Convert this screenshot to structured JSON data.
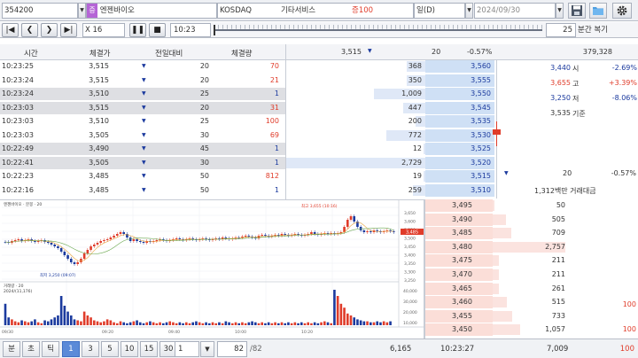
{
  "topbar": {
    "code": "354200",
    "badge": "증",
    "name": "엔젠바이오",
    "market": "KOSDAQ",
    "sector": "기타서비스",
    "margin": "증100",
    "period": "일(D)",
    "date": "2024/09/30"
  },
  "ctrl": {
    "speed": "X 16",
    "time": "10:23",
    "replay_min": "25",
    "replay_label": "분간 복기"
  },
  "trade_table": {
    "headers": [
      "시간",
      "체결가",
      "전일대비",
      "체결량"
    ],
    "rows": [
      {
        "time": "10:23:25",
        "price": "3,515",
        "diff": "20",
        "vol": "70",
        "vol_color": "red",
        "shade": false
      },
      {
        "time": "10:23:24",
        "price": "3,515",
        "diff": "20",
        "vol": "21",
        "vol_color": "red",
        "shade": false
      },
      {
        "time": "10:23:24",
        "price": "3,510",
        "diff": "25",
        "vol": "1",
        "vol_color": "blue",
        "shade": true
      },
      {
        "time": "10:23:03",
        "price": "3,515",
        "diff": "20",
        "vol": "31",
        "vol_color": "red",
        "shade": true
      },
      {
        "time": "10:23:03",
        "price": "3,510",
        "diff": "25",
        "vol": "100",
        "vol_color": "red",
        "shade": false
      },
      {
        "time": "10:23:03",
        "price": "3,505",
        "diff": "30",
        "vol": "69",
        "vol_color": "red",
        "shade": false
      },
      {
        "time": "10:22:49",
        "price": "3,490",
        "diff": "45",
        "vol": "1",
        "vol_color": "blue",
        "shade": true
      },
      {
        "time": "10:22:41",
        "price": "3,505",
        "diff": "30",
        "vol": "1",
        "vol_color": "blue",
        "shade": true
      },
      {
        "time": "10:22:23",
        "price": "3,485",
        "diff": "50",
        "vol": "812",
        "vol_color": "red",
        "shade": false
      },
      {
        "time": "10:22:16",
        "price": "3,485",
        "diff": "50",
        "vol": "1",
        "vol_color": "blue",
        "shade": false
      }
    ]
  },
  "orderbook_header": {
    "price": "3,515",
    "diff": "20",
    "pct": "-0.57%",
    "total": "379,328"
  },
  "asks": [
    {
      "qty": "368",
      "price": "3,560",
      "bar": 0.13
    },
    {
      "qty": "350",
      "price": "3,555",
      "bar": 0.13
    },
    {
      "qty": "1,009",
      "price": "3,550",
      "bar": 0.37
    },
    {
      "qty": "447",
      "price": "3,545",
      "bar": 0.16
    },
    {
      "qty": "200",
      "price": "3,535",
      "bar": 0.07
    },
    {
      "qty": "772",
      "price": "3,530",
      "bar": 0.28
    },
    {
      "qty": "12",
      "price": "3,525",
      "bar": 0.01
    },
    {
      "qty": "2,729",
      "price": "3,520",
      "bar": 1.0
    },
    {
      "qty": "19",
      "price": "3,515",
      "bar": 0.01
    },
    {
      "qty": "259",
      "price": "3,510",
      "bar": 0.09
    }
  ],
  "bids": [
    {
      "price": "3,495",
      "qty": "50",
      "bar": 0.02
    },
    {
      "price": "3,490",
      "qty": "505",
      "bar": 0.18
    },
    {
      "price": "3,485",
      "qty": "709",
      "bar": 0.26
    },
    {
      "price": "3,480",
      "qty": "2,757",
      "bar": 1.0
    },
    {
      "price": "3,475",
      "qty": "211",
      "bar": 0.08
    },
    {
      "price": "3,470",
      "qty": "211",
      "bar": 0.08
    },
    {
      "price": "3,465",
      "qty": "261",
      "bar": 0.09
    },
    {
      "price": "3,460",
      "qty": "515",
      "bar": 0.19
    },
    {
      "price": "3,455",
      "qty": "733",
      "bar": 0.27
    },
    {
      "price": "3,450",
      "qty": "1,057",
      "bar": 0.38
    }
  ],
  "bid_side_extra": {
    "r8": "100",
    "r10": "100"
  },
  "summary": {
    "rows": [
      {
        "val": "3,440",
        "label": "시",
        "pct": "-2.69%",
        "color": "blue"
      },
      {
        "val": "3,655",
        "label": "고",
        "pct": "+3.39%",
        "color": "red"
      },
      {
        "val": "3,250",
        "label": "저",
        "pct": "-8.06%",
        "color": "blue"
      },
      {
        "val": "3,535",
        "label": "기준",
        "pct": "",
        "color": "dark"
      }
    ],
    "diff": "20",
    "pct": "-0.57%",
    "volume": "1,312백만 거래대금"
  },
  "chart": {
    "price_label": "엔젠바이오 · 분봉 · 20",
    "high_label": "최고 3,655 (10:16)",
    "low_label": "최저 3,250 (09:07)",
    "vol_label": "거래량 · 20",
    "vol_date": "2024/(11,176)",
    "price_ticks": [
      "3,650",
      "3,600",
      "3,550",
      "3,500",
      "3,450",
      "3,400",
      "3,350",
      "3,300",
      "3,250"
    ],
    "vol_ticks": [
      "40,000",
      "30,000",
      "20,000",
      "10,000"
    ],
    "time_ticks": [
      "09/30",
      "09:20",
      "09:40",
      "10:00",
      "10:20"
    ],
    "current_price": "3,485"
  },
  "footer": {
    "btn_min": "분",
    "btn_sec": "초",
    "btn_tick": "틱",
    "intervals": [
      "1",
      "3",
      "5",
      "10",
      "15",
      "30"
    ],
    "sel": "1",
    "page": "82",
    "total": "/82",
    "ask_total": "6,165",
    "time": "10:23:27",
    "bid_total": "7,009",
    "bid_right": "100"
  }
}
